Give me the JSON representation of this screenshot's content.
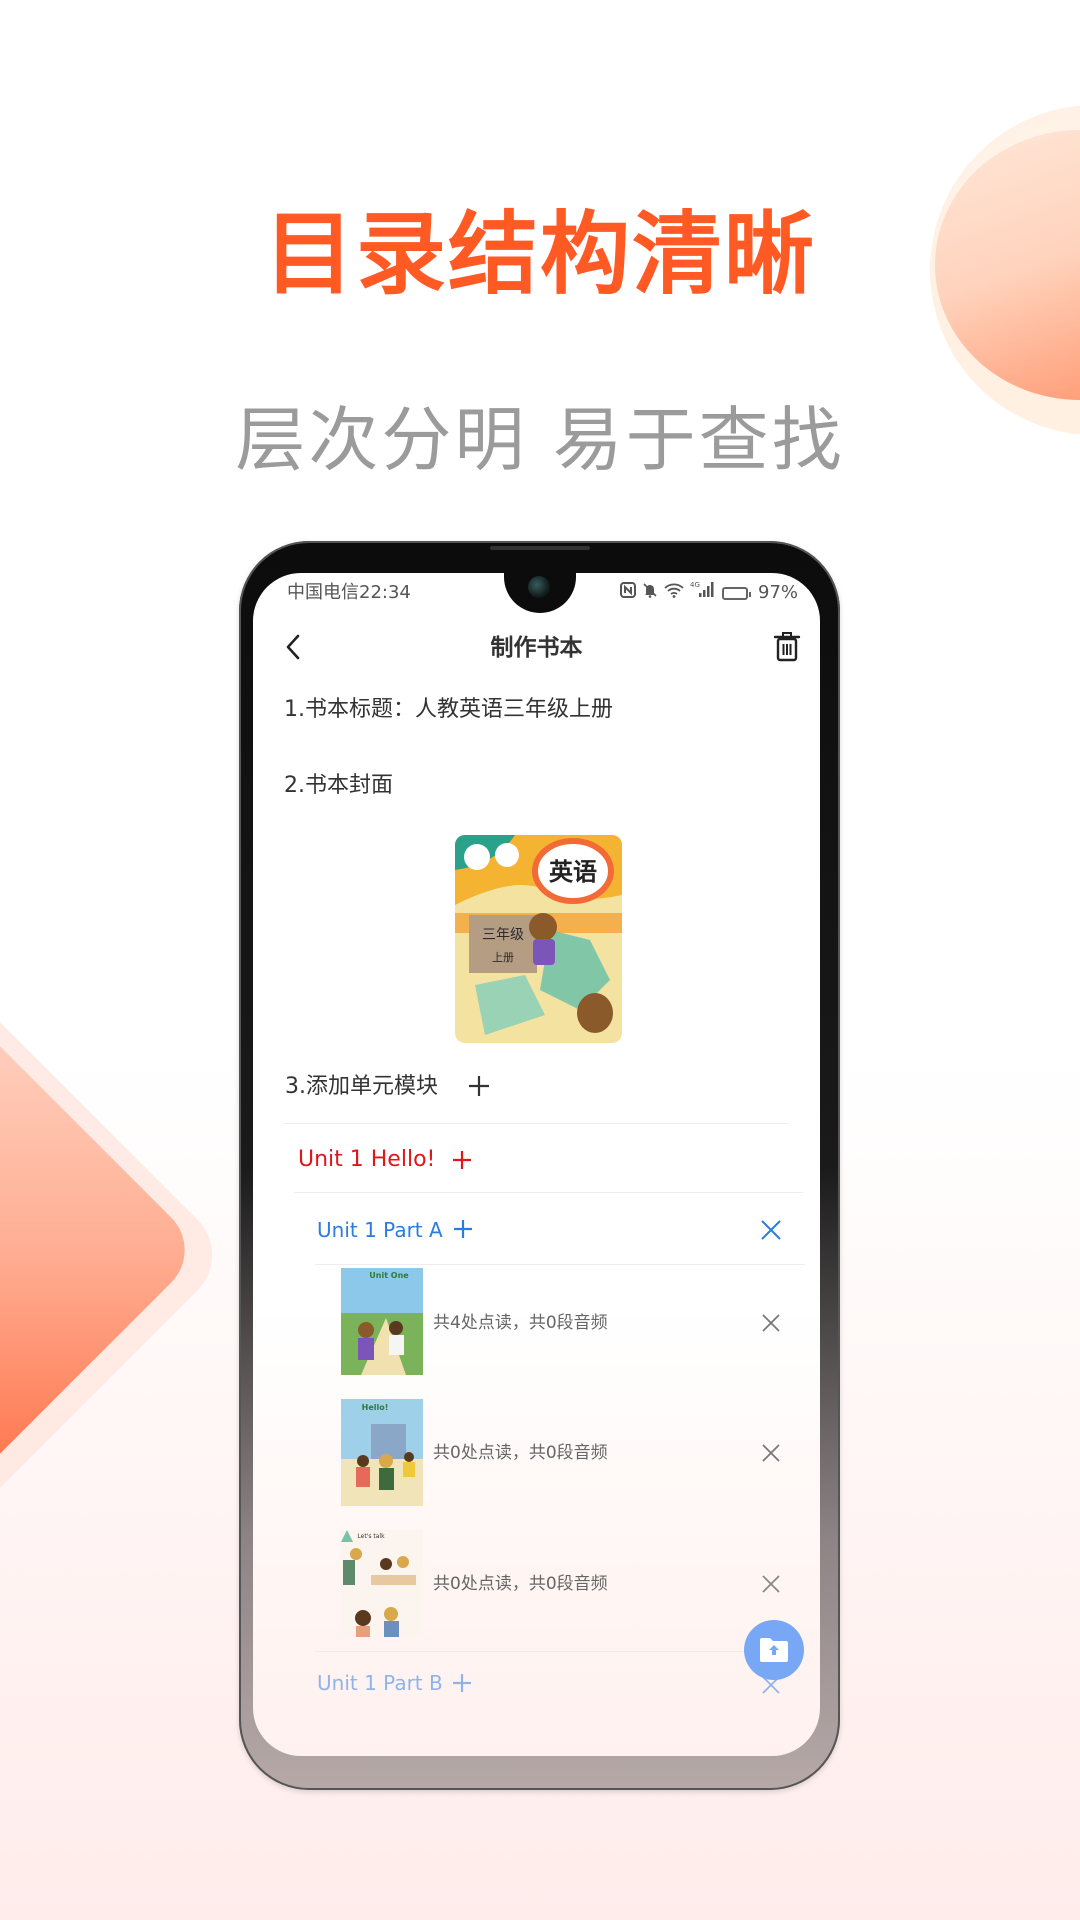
{
  "promo": {
    "headline": "目录结构清晰",
    "subheadline": "层次分明 易于查找",
    "accent_color": "#ff5a24"
  },
  "status_bar": {
    "carrier_time": "中国电信22:34",
    "icons": [
      "nfc-icon",
      "mute-bell-icon",
      "wifi-icon",
      "4g-signal-icon",
      "battery-charging-icon"
    ],
    "network_label": "4G",
    "battery": "97%"
  },
  "header": {
    "title": "制作书本",
    "back_icon": "chevron-left-icon",
    "delete_icon": "trash-icon"
  },
  "form": {
    "title_row": "1.书本标题：人教英语三年级上册",
    "cover_label": "2.书本封面",
    "cover": {
      "title": "英语",
      "grade": "三年级",
      "volume": "上册"
    },
    "add_unit_label": "3.添加单元模块",
    "add_symbol": "+"
  },
  "units": [
    {
      "name": "Unit 1 Hello!",
      "color": "#e0161b",
      "parts": [
        {
          "name": "Unit 1 Part A",
          "color": "#2a7ce0",
          "pages": [
            {
              "thumb_label": "Unit One",
              "summary": "共4处点读，共0段音频"
            },
            {
              "thumb_label": "Hello!",
              "summary": "共0处点读，共0段音频"
            },
            {
              "thumb_label": "Let's talk",
              "summary": "共0处点读，共0段音频"
            }
          ]
        },
        {
          "name": "Unit 1 Part B",
          "color": "#8fb4ec",
          "pages": []
        }
      ]
    }
  ],
  "fab": {
    "icon": "folder-upload-icon",
    "color": "#78a8f5"
  }
}
